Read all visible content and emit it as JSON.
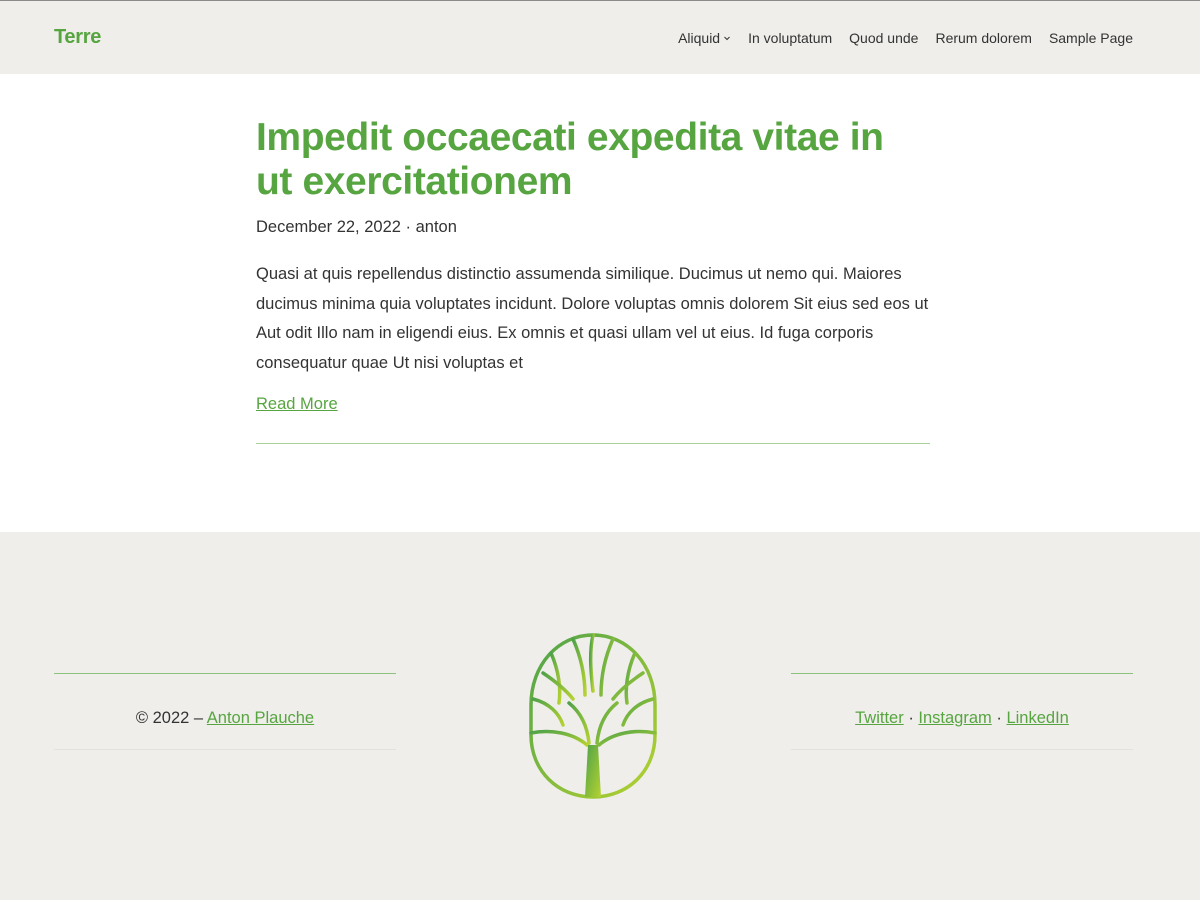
{
  "site": {
    "title": "Terre"
  },
  "nav": {
    "items": [
      {
        "label": "Aliquid",
        "has_submenu": true
      },
      {
        "label": "In voluptatum"
      },
      {
        "label": "Quod unde"
      },
      {
        "label": "Rerum dolorem"
      },
      {
        "label": "Sample Page"
      }
    ]
  },
  "post": {
    "title": "Impedit occaecati expedita vitae in ut exercitationem",
    "date": "December 22, 2022",
    "separator": "·",
    "author": "anton",
    "excerpt": "Quasi at quis repellendus distinctio assumenda similique. Ducimus ut nemo qui. Maiores ducimus minima quia voluptates incidunt. Dolore voluptas omnis dolorem Sit eius sed eos ut Aut odit Illo nam in eligendi eius. Ex omnis et quasi ullam vel ut eius. Id fuga corporis consequatur quae Ut nisi voluptas et",
    "read_more": "Read More"
  },
  "footer": {
    "copyright_prefix": "© 2022 –",
    "copyright_link": "Anton Plauche",
    "social": [
      {
        "label": "Twitter"
      },
      {
        "label": "Instagram"
      },
      {
        "label": "LinkedIn"
      }
    ],
    "social_separator": "·",
    "logo_icon": "tree-icon"
  },
  "colors": {
    "accent": "#57a540",
    "header_bg": "#efeeeb",
    "footer_bg": "#efeeeb"
  }
}
